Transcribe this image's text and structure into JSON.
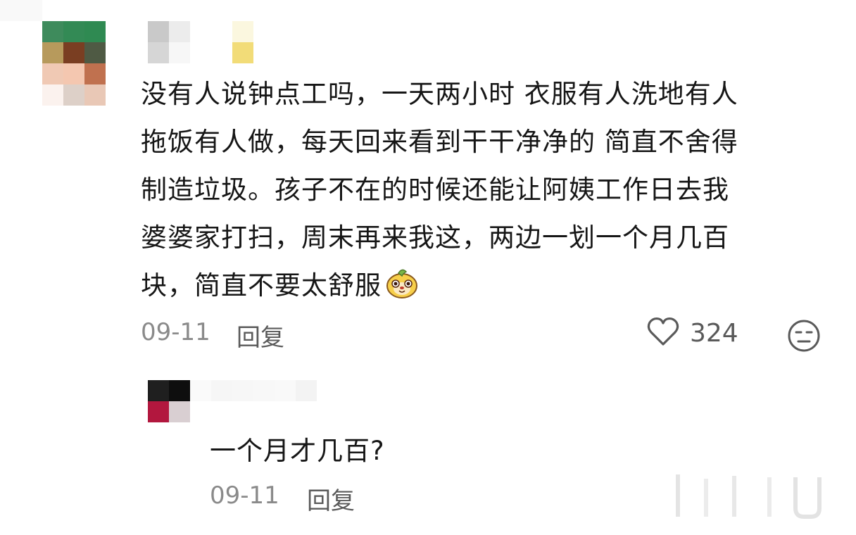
{
  "comment": {
    "lines": [
      "没有人说钟点工吗，一天两小时 衣服有人洗地有人",
      "拖饭有人做，每天回来看到干干净净的 简直不舍得",
      "制造垃圾。孩子不在的时候还能让阿姨工作日去我",
      "婆婆家打扫，周末再来我这，两边一划一个月几百",
      "块，简直不要太舒服"
    ],
    "emoji_icon": "cute-animal-emoji",
    "date": "09-11",
    "reply_label": "回复",
    "like_count": "324",
    "like_icon": "heart-outline-icon",
    "dislike_icon": "meh-face-icon"
  },
  "reply": {
    "text": "一个月才几百?",
    "date": "09-11",
    "reply_label": "回复"
  },
  "colors": {
    "text": "#161616",
    "meta_grey": "#8a8a8a",
    "action_grey": "#5a5a5a"
  }
}
